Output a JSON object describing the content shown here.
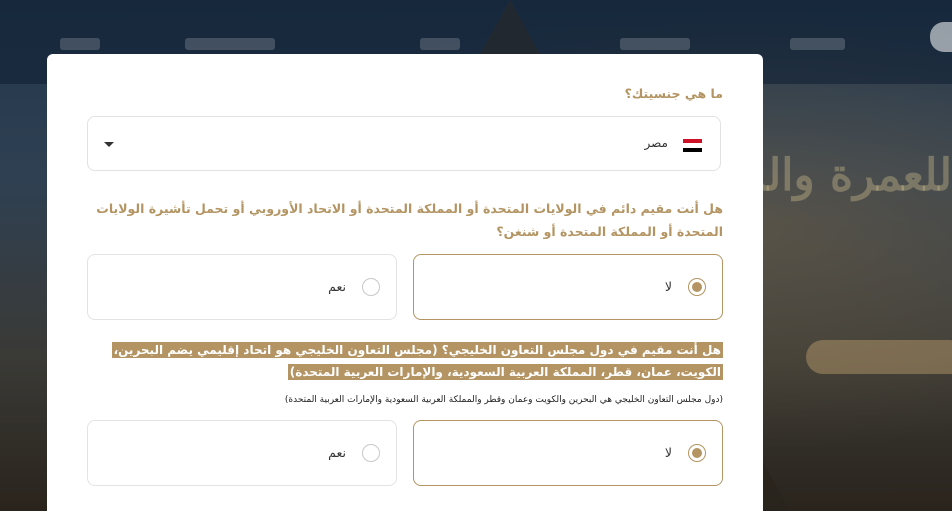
{
  "colors": {
    "accent": "#b39462",
    "border": "#e3e3e3",
    "text": "#333333"
  },
  "form": {
    "nationality": {
      "question": "ما هي جنسيتك؟",
      "selected_value": "مصر",
      "flag_icon": "egypt-flag-icon"
    },
    "residency": {
      "question": "هل أنت مقيم دائم في الولايات المتحدة أو المملكة المتحدة أو الاتحاد الأوروبي أو تحمل تأشيرة الولايات المتحدة أو المملكة المتحدة أو شنغن؟",
      "options": [
        {
          "label": "لا",
          "selected": true
        },
        {
          "label": "نعم",
          "selected": false
        }
      ]
    },
    "gcc": {
      "question": "هل أنت مقيم في دول مجلس التعاون الخليجي؟ (مجلس التعاون الخليجي هو اتحاد إقليمي يضم البحرين، الكويت، عمان، قطر، المملكة العربية السعودية، والإمارات العربية المتحدة)",
      "hint": "(دول مجلس التعاون الخليجي هي البحرين والكويت وعمان وقطر والمملكة العربية السعودية والإمارات العربية المتحدة)",
      "options": [
        {
          "label": "لا",
          "selected": true
        },
        {
          "label": "نعم",
          "selected": false
        }
      ]
    }
  }
}
